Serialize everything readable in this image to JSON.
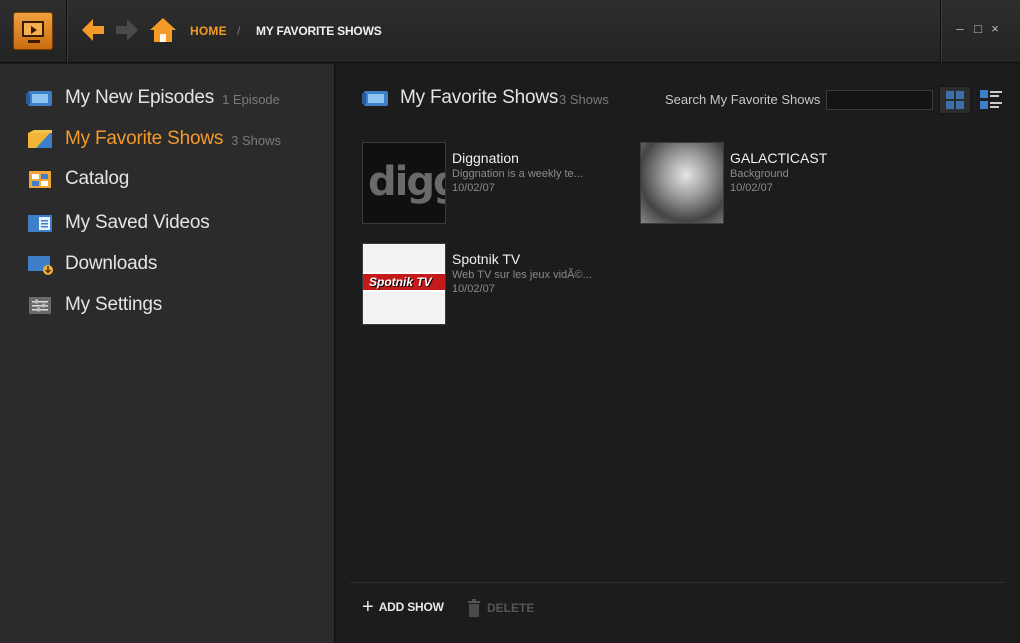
{
  "header": {
    "breadcrumb_home": "HOME",
    "breadcrumb_sep": "/",
    "breadcrumb_current": "MY FAVORITE SHOWS",
    "minimize": "–",
    "maximize": "□",
    "close": "×"
  },
  "sidebar": {
    "items": [
      {
        "label": "My New Episodes",
        "count": "1 Episode",
        "icon": "new-episodes-icon"
      },
      {
        "label": "My Favorite Shows",
        "count": "3 Shows",
        "icon": "favorite-shows-icon",
        "active": true
      },
      {
        "label": "Catalog",
        "count": "",
        "icon": "catalog-icon"
      },
      {
        "label": "My Saved Videos",
        "count": "",
        "icon": "saved-videos-icon"
      },
      {
        "label": "Downloads",
        "count": "",
        "icon": "downloads-icon"
      },
      {
        "label": "My Settings",
        "count": "",
        "icon": "settings-icon"
      }
    ]
  },
  "main": {
    "title": "My Favorite Shows",
    "count": "3 Shows",
    "search_label": "Search My Favorite Shows",
    "search_value": "",
    "shows": [
      {
        "title": "Diggnation",
        "desc": "Diggnation is a weekly te...",
        "date": "10/02/07",
        "thumb_text": "digg"
      },
      {
        "title": "GALACTICAST",
        "desc": "Background",
        "date": "10/02/07",
        "thumb_text": ""
      },
      {
        "title": "Spotnik TV",
        "desc": "Web TV sur les jeux vidÃ©...",
        "date": "10/02/07",
        "thumb_text": "Spotnik TV"
      }
    ],
    "add_show": "ADD SHOW",
    "delete": "DELETE"
  },
  "colors": {
    "accent": "#f39a27",
    "background": "#1c1c1c",
    "sidebar": "#2b2b2b"
  }
}
